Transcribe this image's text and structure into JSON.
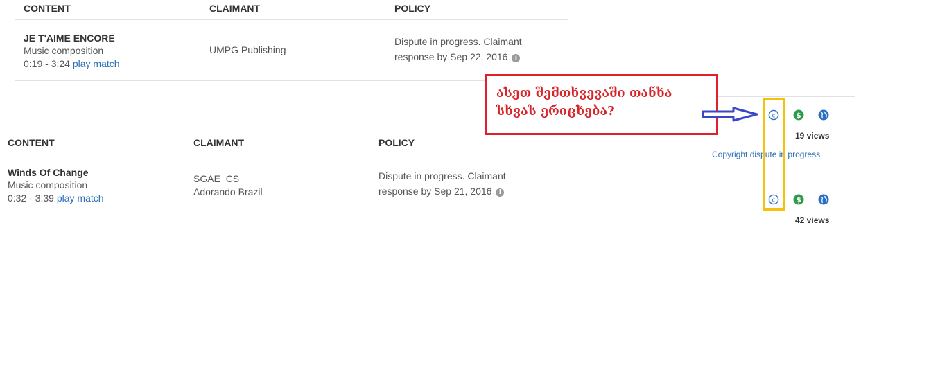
{
  "table1": {
    "headers": {
      "content": "CONTENT",
      "claimant": "CLAIMANT",
      "policy": "POLICY"
    },
    "row": {
      "title": "JE T'AIME ENCORE",
      "type": "Music composition",
      "range": "0:19 - 3:24",
      "play_match": "play match",
      "claimant_line1": "UMPG Publishing",
      "policy_line1": "Dispute in progress. Claimant",
      "policy_line2": "response by Sep 22, 2016"
    }
  },
  "table2": {
    "headers": {
      "content": "CONTENT",
      "claimant": "CLAIMANT",
      "policy": "POLICY"
    },
    "row": {
      "title": "Winds Of Change",
      "type": "Music composition",
      "range": "0:32 - 3:39",
      "play_match": "play match",
      "claimant_line1": "SGAE_CS",
      "claimant_line2": "Adorando Brazil",
      "policy_line1": "Dispute in progress. Claimant",
      "policy_line2": "response by Sep 21, 2016"
    }
  },
  "video_rows": [
    {
      "views": "19 views",
      "status_link": "Copyright dispute in progress"
    },
    {
      "views": "42 views"
    }
  ],
  "info_glyph": "i",
  "copyright_glyph": "c",
  "money_glyph": "$",
  "annotation": {
    "text": "ასეთ შემთხვევაში თანხა სხვას ერიცხება?"
  },
  "colors": {
    "link": "#2a6fb5",
    "annotation_red": "#e0202a",
    "highlight_yellow": "#f4c20d",
    "arrow_blue": "#3b47c4",
    "money_green": "#2e9a4a",
    "globe_blue": "#2b6fc2"
  }
}
